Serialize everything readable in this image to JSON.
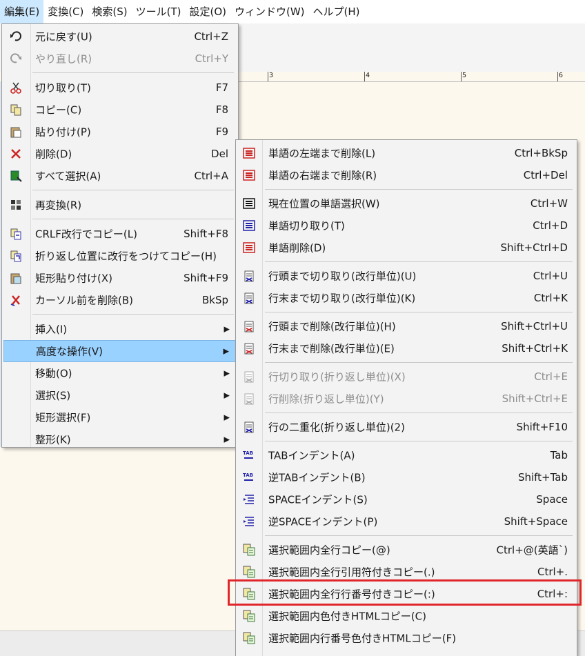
{
  "menubar": [
    {
      "label": "編集(E)",
      "active": true
    },
    {
      "label": "変換(C)"
    },
    {
      "label": "検索(S)"
    },
    {
      "label": "ツール(T)"
    },
    {
      "label": "設定(O)"
    },
    {
      "label": "ウィンドウ(W)"
    },
    {
      "label": "ヘルプ(H)"
    }
  ],
  "ruler": {
    "ticks": [
      "3",
      "4",
      "5",
      "6"
    ]
  },
  "edit_menu": {
    "items": [
      {
        "label": "元に戻す(U)",
        "shortcut": "Ctrl+Z",
        "icon": "undo-icon"
      },
      {
        "label": "やり直し(R)",
        "shortcut": "Ctrl+Y",
        "icon": "redo-icon",
        "disabled": true
      },
      {
        "label": "切り取り(T)",
        "shortcut": "F7",
        "icon": "scissors-icon"
      },
      {
        "label": "コピー(C)",
        "shortcut": "F8",
        "icon": "copy-icon"
      },
      {
        "label": "貼り付け(P)",
        "shortcut": "F9",
        "icon": "paste-icon"
      },
      {
        "label": "削除(D)",
        "shortcut": "Del",
        "icon": "delete-x-icon"
      },
      {
        "label": "すべて選択(A)",
        "shortcut": "Ctrl+A",
        "icon": "select-all-icon"
      },
      {
        "label": "再変換(R)",
        "shortcut": "",
        "icon": "reconvert-icon"
      },
      {
        "label": "CRLF改行でコピー(L)",
        "shortcut": "Shift+F8",
        "icon": "copy-crlf-icon"
      },
      {
        "label": "折り返し位置に改行をつけてコピー(H)",
        "shortcut": "",
        "icon": "copy-wrap-icon"
      },
      {
        "label": "矩形貼り付け(X)",
        "shortcut": "Shift+F9",
        "icon": "box-paste-icon"
      },
      {
        "label": "カーソル前を削除(B)",
        "shortcut": "BkSp",
        "icon": "backspace-x-icon"
      },
      {
        "label": "挿入(I)",
        "submenu": true
      },
      {
        "label": "高度な操作(V)",
        "submenu": true,
        "highlight": true
      },
      {
        "label": "移動(O)",
        "submenu": true
      },
      {
        "label": "選択(S)",
        "submenu": true
      },
      {
        "label": "矩形選択(F)",
        "submenu": true
      },
      {
        "label": "整形(K)",
        "submenu": true
      }
    ]
  },
  "advanced_menu": {
    "items": [
      {
        "label": "単語の左端まで削除(L)",
        "shortcut": "Ctrl+BkSp",
        "icon": "word-left-delete-icon"
      },
      {
        "label": "単語の右端まで削除(R)",
        "shortcut": "Ctrl+Del",
        "icon": "word-right-delete-icon"
      },
      {
        "label": "現在位置の単語選択(W)",
        "shortcut": "Ctrl+W",
        "icon": "word-select-icon"
      },
      {
        "label": "単語切り取り(T)",
        "shortcut": "Ctrl+D",
        "icon": "word-cut-icon"
      },
      {
        "label": "単語削除(D)",
        "shortcut": "Shift+Ctrl+D",
        "icon": "word-delete-icon"
      },
      {
        "label": "行頭まで切り取り(改行単位)(U)",
        "shortcut": "Ctrl+U",
        "icon": "cut-to-line-start-icon"
      },
      {
        "label": "行末まで切り取り(改行単位)(K)",
        "shortcut": "Ctrl+K",
        "icon": "cut-to-line-end-icon"
      },
      {
        "label": "行頭まで削除(改行単位)(H)",
        "shortcut": "Shift+Ctrl+U",
        "icon": "delete-to-line-start-icon"
      },
      {
        "label": "行末まで削除(改行単位)(E)",
        "shortcut": "Shift+Ctrl+K",
        "icon": "delete-to-line-end-icon"
      },
      {
        "label": "行切り取り(折り返し単位)(X)",
        "shortcut": "Ctrl+E",
        "icon": "line-cut-icon",
        "disabled": true
      },
      {
        "label": "行削除(折り返し単位)(Y)",
        "shortcut": "Shift+Ctrl+E",
        "icon": "line-delete-icon",
        "disabled": true
      },
      {
        "label": "行の二重化(折り返し単位)(2)",
        "shortcut": "Shift+F10",
        "icon": "line-duplicate-icon"
      },
      {
        "label": "TABインデント(A)",
        "shortcut": "Tab",
        "icon": "tab-indent-icon"
      },
      {
        "label": "逆TABインデント(B)",
        "shortcut": "Shift+Tab",
        "icon": "tab-unindent-icon"
      },
      {
        "label": "SPACEインデント(S)",
        "shortcut": "Space",
        "icon": "space-indent-icon"
      },
      {
        "label": "逆SPACEインデント(P)",
        "shortcut": "Shift+Space",
        "icon": "space-unindent-icon"
      },
      {
        "label": "選択範囲内全行コピー(@)",
        "shortcut": "Ctrl+@(英語`)",
        "icon": "copy-lines-icon"
      },
      {
        "label": "選択範囲内全行引用符付きコピー(.)",
        "shortcut": "Ctrl+.",
        "icon": "copy-quoted-icon"
      },
      {
        "label": "選択範囲内全行行番号付きコピー(:)",
        "shortcut": "Ctrl+:",
        "icon": "copy-line-numbers-icon",
        "boxed": true
      },
      {
        "label": "選択範囲内色付きHTMLコピー(C)",
        "shortcut": "",
        "icon": "copy-html-icon"
      },
      {
        "label": "選択範囲内行番号色付きHTMLコピー(F)",
        "shortcut": "",
        "icon": "copy-html-numbers-icon"
      }
    ]
  },
  "colors": {
    "highlight": "#99d1ff",
    "callout": "#e0262b",
    "menu_bg": "#f3f3f3"
  }
}
